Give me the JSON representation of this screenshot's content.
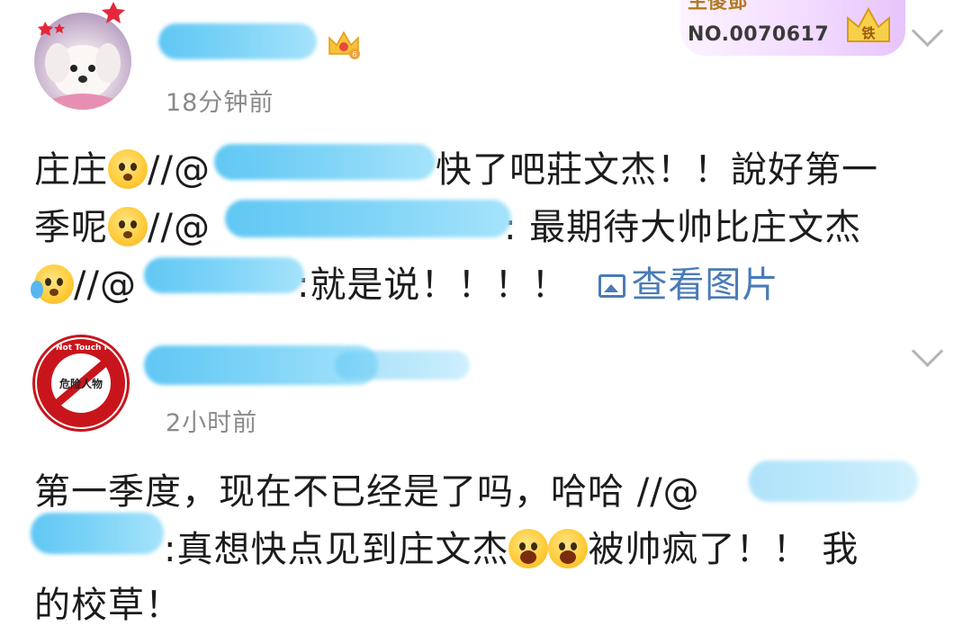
{
  "comments": [
    {
      "timestamp": "18分钟前",
      "fan_badge": {
        "title": "主傻鄧",
        "number": "NO.0070617",
        "level": "铁"
      },
      "lines": [
        {
          "t1": "庄庄",
          "t2": "//@",
          "t3": "快了吧莊文杰！！說好第一"
        },
        {
          "t1": "季呢",
          "t2": "//@",
          "t3": ": 最期待大帅比庄文杰"
        },
        {
          "t2": "//@",
          "t3": ":就是说！！！！",
          "link": "查看图片"
        }
      ]
    },
    {
      "timestamp": "2小时前",
      "avatar_text_top": "Do Not Touch Me!",
      "avatar_text_mid": "危险人物",
      "lines": [
        {
          "t1": "第一季度，现在不已经是了吗，哈哈 //@"
        },
        {
          "t1": ":真想快点见到庄文杰",
          "t3": "被帅疯了！！ 我"
        },
        {
          "t1": "的校草！"
        }
      ]
    }
  ],
  "icons": {
    "expand": "chevron-down-icon",
    "picture": "picture-icon",
    "crown": "crown-badge-icon"
  },
  "colors": {
    "blur": "#7fd4f7",
    "link": "#4a7bb6",
    "timestamp": "#8a8a8a",
    "badge": "#e7c4fb"
  }
}
